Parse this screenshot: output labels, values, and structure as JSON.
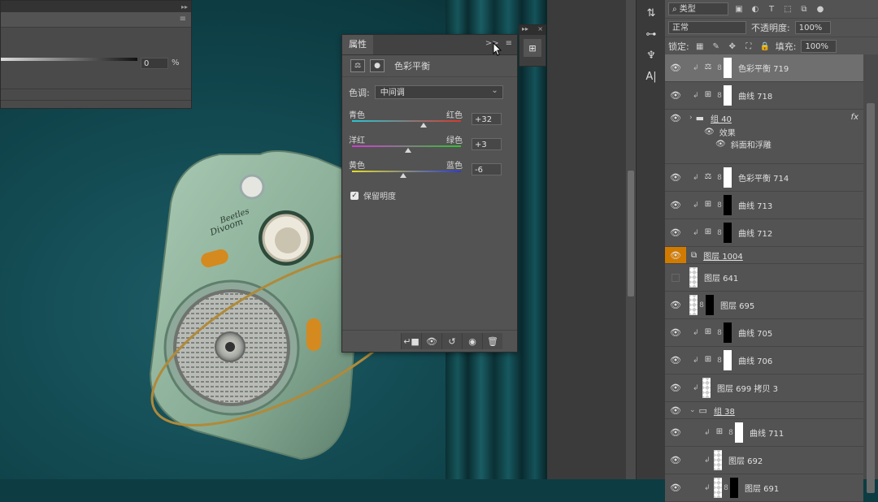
{
  "colors": {
    "accent_orange": "#d17a00",
    "cyan_red_track": [
      "#27c6d4",
      "#d63a2e"
    ],
    "magenta_green_track": [
      "#d23ad6",
      "#2ec42e"
    ],
    "yellow_blue_track": [
      "#e6dc2a",
      "#2a3cd6"
    ],
    "radio_body": "#8fb39b",
    "gold_ring": "#b08a3a"
  },
  "channel_panel": {
    "menu_glyph": "≡",
    "value": "0",
    "unit": "%"
  },
  "properties": {
    "tab_label": "属性",
    "collapse_glyph": ">>",
    "menu_glyph": "≡",
    "header_label": "色彩平衡",
    "tone_label": "色调:",
    "tone_value": "中间调",
    "sliders": [
      {
        "left": "青色",
        "right": "红色",
        "value_text": "+32",
        "value": 32
      },
      {
        "left": "洋红",
        "right": "绿色",
        "value_text": "+3",
        "value": 3
      },
      {
        "left": "黄色",
        "right": "蓝色",
        "value_text": "-6",
        "value": -6
      }
    ],
    "preserve_label": "保留明度",
    "preserve_checked": true,
    "footer_icons": [
      "clip-to-layer-icon",
      "view-previous-icon",
      "reset-icon",
      "visibility-icon",
      "trash-icon"
    ]
  },
  "dock_mini": {
    "collapse_glyph": "▸▸",
    "close_glyph": "×"
  },
  "radio_label": {
    "brand_line1": "Beetles",
    "brand_line2": "Divoom"
  },
  "layers_panel": {
    "filter_label": "类型",
    "blend_mode": "正常",
    "opacity_label": "不透明度:",
    "opacity_value": "100%",
    "lock_label": "锁定:",
    "fill_label": "填充:",
    "fill_value": "100%",
    "layers": [
      {
        "name": "色彩平衡 719",
        "type": "adjust",
        "icon": "color-balance-icon",
        "mask": "white",
        "clip": true,
        "selected": true,
        "visible": true
      },
      {
        "name": "曲线 718",
        "type": "adjust",
        "icon": "curves-icon",
        "mask": "white",
        "clip": true,
        "visible": true
      },
      {
        "name": "组 40",
        "type": "group",
        "visible": true,
        "fx": "fx",
        "underline": true
      },
      {
        "name": "色彩平衡 714",
        "type": "adjust",
        "icon": "color-balance-icon",
        "mask": "white",
        "clip": true,
        "visible": true
      },
      {
        "name": "曲线 713",
        "type": "adjust",
        "icon": "curves-icon",
        "mask": "black",
        "clip": true,
        "visible": true
      },
      {
        "name": "曲线 712",
        "type": "adjust",
        "icon": "curves-icon",
        "mask": "black",
        "clip": true,
        "visible": true
      },
      {
        "name": "图层 1004",
        "type": "smart",
        "visible": true,
        "orange": true,
        "underline": true
      },
      {
        "name": "图层 641",
        "type": "pixel",
        "visible": false
      },
      {
        "name": "图层 695",
        "type": "pixel-mask",
        "mask": "black",
        "visible": true
      },
      {
        "name": "曲线 705",
        "type": "adjust",
        "icon": "curves-icon",
        "mask": "black",
        "clip": true,
        "visible": true
      },
      {
        "name": "曲线 706",
        "type": "adjust",
        "icon": "curves-icon",
        "mask": "white",
        "clip": true,
        "visible": true
      },
      {
        "name": "图层 699 拷贝 3",
        "type": "pixel",
        "clip": true,
        "visible": true
      },
      {
        "name": "组 38",
        "type": "group-open",
        "visible": true,
        "underline": true
      },
      {
        "name": "曲线 711",
        "type": "adjust",
        "icon": "curves-icon",
        "mask": "white",
        "clip": true,
        "visible": true,
        "indent": true
      },
      {
        "name": "图层 692",
        "type": "pixel",
        "clip": true,
        "visible": true,
        "indent": true
      },
      {
        "name": "图层 691",
        "type": "pixel-mask",
        "mask": "black",
        "clip": true,
        "visible": true,
        "indent": true
      }
    ],
    "effects_label": "效果",
    "effect_item": "斜面和浮雕"
  }
}
